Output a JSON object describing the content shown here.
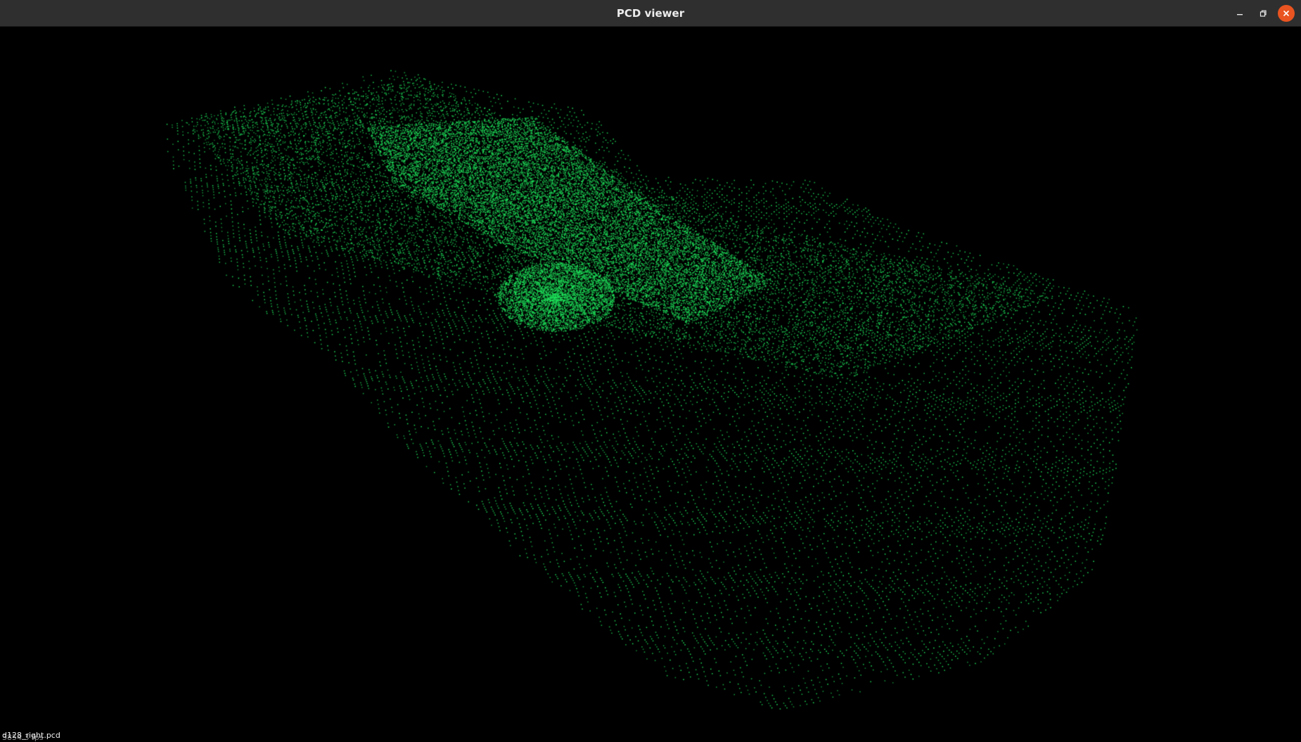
{
  "window": {
    "title": "PCD viewer",
    "controls": {
      "minimize": "minimize-icon",
      "maximize": "restore-icon",
      "close": "close-icon"
    },
    "colors": {
      "titlebar": "#2f2f2f",
      "close_button": "#e95420"
    }
  },
  "viewer": {
    "background": "#000000",
    "point_color": "#1ee05a",
    "status": {
      "file_name": "d128_right.pcd",
      "overlay_text": "3854 3 fps"
    }
  }
}
